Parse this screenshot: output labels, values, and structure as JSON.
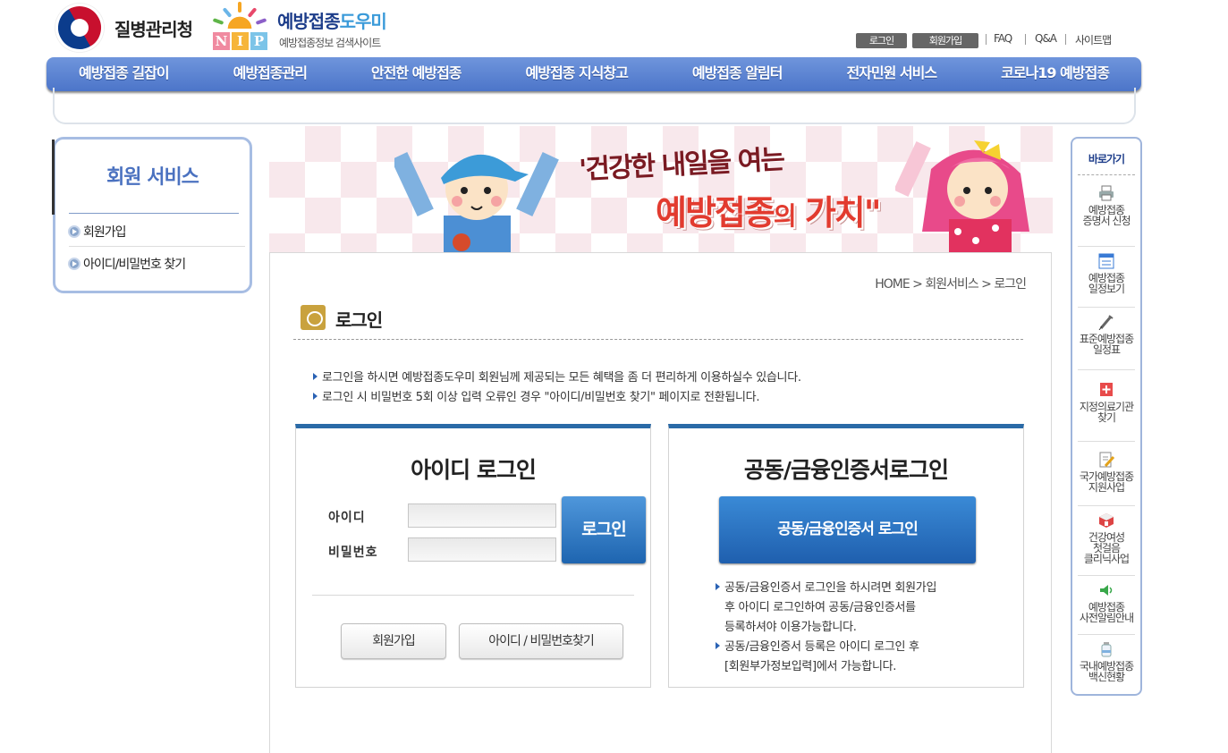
{
  "header": {
    "org_name": "질병관리청",
    "site_title_main": "예방접종",
    "site_title_accent": "도우미",
    "site_subtitle": "예방접종정보 검색사이트",
    "logo_letters": [
      "N",
      "I",
      "P"
    ],
    "top_buttons": {
      "login": "로그인",
      "join": "회원가입"
    },
    "top_links": [
      "FAQ",
      "Q&A",
      "사이트맵"
    ]
  },
  "gnb": [
    "예방접종 길잡이",
    "예방접종관리",
    "안전한 예방접종",
    "예방접종 지식창고",
    "예방접종 알림터",
    "전자민원 서비스",
    "코로나19 예방접종"
  ],
  "lnb": {
    "title": "회원 서비스",
    "items": [
      "회원가입",
      "아이디/비밀번호 찾기"
    ]
  },
  "banner": {
    "line1": "'건강한 내일을 여는",
    "line2_a": "예방접종",
    "line2_b": "의",
    "line2_c": " 가치\""
  },
  "main": {
    "breadcrumb": "HOME > 회원서비스 > 로그인",
    "page_title": "로그인",
    "notices": [
      "로그인을 하시면 예방접종도우미 회원님께 제공되는 모든 혜택을 좀 더 편리하게 이용하실수 있습니다.",
      "로그인 시 비밀번호 5회 이상 입력 오류인 경우 \"아이디/비밀번호 찾기\" 페이지로 전환됩니다."
    ],
    "id_login": {
      "title": "아이디 로그인",
      "id_label": "아이디",
      "pw_label": "비밀번호",
      "id_value": "",
      "pw_value": "",
      "login_button": "로그인",
      "join_button": "회원가입",
      "find_button": "아이디 / 비밀번호찾기"
    },
    "cert_login": {
      "title": "공동/금융인증서로그인",
      "button": "공동/금융인증서 로그인",
      "notes": [
        [
          "공동/금융인증서 로그인을 하시려면 회원가입",
          "후 아이디 로그인하여 공동/금융인증서를",
          "등록하셔야 이용가능합니다."
        ],
        [
          "공동/금융인증서 등록은 아이디 로그인 후",
          "[회원부가정보입력]에서 가능합니다."
        ]
      ]
    }
  },
  "quick": {
    "title": "바로가기",
    "items": [
      {
        "icon": "printer-icon",
        "lines": [
          "예방접종",
          "증명서 신청"
        ]
      },
      {
        "icon": "calendar-list-icon",
        "lines": [
          "예방접종",
          "일정보기"
        ]
      },
      {
        "icon": "syringe-icon",
        "lines": [
          "표준예방접종",
          "일정표"
        ]
      },
      {
        "icon": "hospital-cross-icon",
        "lines": [
          "지정의료기관",
          "찾기"
        ]
      },
      {
        "icon": "document-pencil-icon",
        "lines": [
          "국가예방접종",
          "지원사업"
        ]
      },
      {
        "icon": "medical-kit-icon",
        "lines": [
          "건강여성",
          "첫걸음",
          "클리닉사업"
        ]
      },
      {
        "icon": "speaker-icon",
        "lines": [
          "예방접종",
          "사전알림안내"
        ]
      },
      {
        "icon": "vaccine-bottle-icon",
        "lines": [
          "국내예방접종",
          "백신현황"
        ]
      }
    ]
  }
}
